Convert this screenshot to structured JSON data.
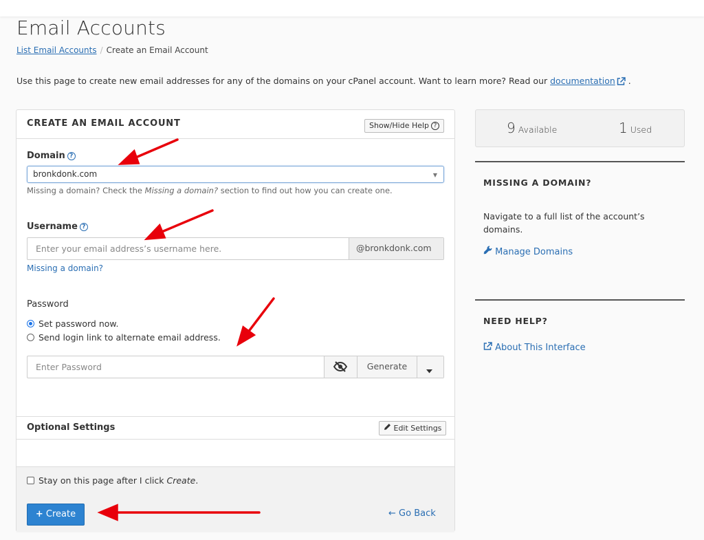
{
  "page": {
    "title": "Email Accounts",
    "breadcrumb": {
      "link": "List Email Accounts",
      "separator": "/",
      "current": "Create an Email Account"
    },
    "intro_text": "Use this page to create new email addresses for any of the domains on your cPanel account. Want to learn more? Read our ",
    "intro_link": "documentation",
    "intro_end": "."
  },
  "form": {
    "title": "CREATE AN EMAIL ACCOUNT",
    "show_hide_help": "Show/Hide Help",
    "domain_label": "Domain",
    "domain_value": "bronkdonk.com",
    "domain_hint_pre": "Missing a domain? Check the ",
    "domain_hint_em": "Missing a domain?",
    "domain_hint_post": " section to find out how you can create one.",
    "username_label": "Username",
    "username_placeholder": "Enter your email address’s username here.",
    "username_suffix": "@bronkdonk.com",
    "missing_domain_link": "Missing a domain?",
    "password_label": "Password",
    "radio_set_now": "Set password now.",
    "radio_send_link": "Send login link to alternate email address.",
    "password_placeholder": "Enter Password",
    "generate": "Generate",
    "optional_settings": "Optional Settings",
    "edit_settings": "Edit Settings",
    "stay_pre": "Stay on this page after I click ",
    "stay_em": "Create",
    "stay_post": ".",
    "create": "Create",
    "go_back": "Go Back"
  },
  "sidebar": {
    "available_count": "9",
    "available_label": "Available",
    "used_count": "1",
    "used_label": "Used",
    "missing_title": "MISSING A DOMAIN?",
    "missing_text": "Navigate to a full list of the account’s domains.",
    "manage_domains": "Manage Domains",
    "help_title": "NEED HELP?",
    "about": "About This Interface"
  },
  "colors": {
    "link": "#2a6eb3",
    "primary_button": "#2d83d1",
    "arrow": "#e8000b"
  }
}
